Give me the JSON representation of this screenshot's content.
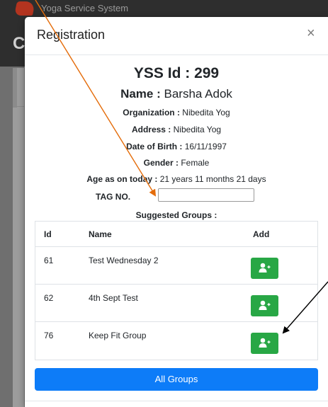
{
  "background": {
    "app_title": "Yoga Service System",
    "left_letter": "C"
  },
  "modal": {
    "title": "Registration",
    "close": "×"
  },
  "member": {
    "yss_label": "YSS Id : ",
    "yss_id": "299",
    "name_label": "Name : ",
    "name": "Barsha Adok",
    "organization_label": "Organization : ",
    "organization": "Nibedita Yog",
    "address_label": "Address : ",
    "address": "Nibedita Yog",
    "dob_label": "Date of Birth : ",
    "dob": "16/11/1997",
    "gender_label": "Gender : ",
    "gender": "Female",
    "age_label": "Age as on today : ",
    "age": "21 years 11 months 21 days"
  },
  "tag": {
    "label": "TAG NO.",
    "value": "",
    "placeholder": ""
  },
  "suggested_title": "Suggested Groups :",
  "table": {
    "headers": [
      "Id",
      "Name",
      "Add"
    ],
    "rows": [
      {
        "id": "61",
        "name": "Test Wednesday 2"
      },
      {
        "id": "62",
        "name": "4th Sept Test"
      },
      {
        "id": "76",
        "name": "Keep Fit Group"
      }
    ]
  },
  "buttons": {
    "all_groups": "All Groups",
    "add_icon": "user-plus-icon"
  },
  "colors": {
    "add_button": "#28a745",
    "primary_button": "#0d7cf8",
    "orange_arrow": "#e46c0a",
    "black_arrow": "#000000"
  }
}
